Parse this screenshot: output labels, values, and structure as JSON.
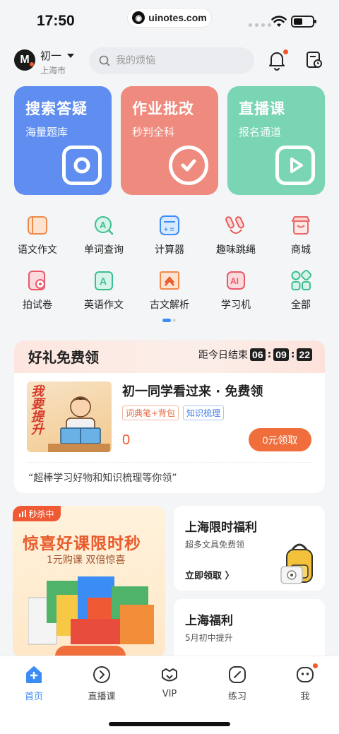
{
  "status": {
    "time": "17:50",
    "url": "uinotes.com"
  },
  "header": {
    "avatar_text": "M",
    "grade": "初一",
    "city": "上海市",
    "search_placeholder": "我的烦恼"
  },
  "big_cards": [
    {
      "title": "搜索答疑",
      "sub": "海量题库",
      "color": "#5f8ef0"
    },
    {
      "title": "作业批改",
      "sub": "秒判全科",
      "color": "#ef8a7e"
    },
    {
      "title": "直播课",
      "sub": "报名通道",
      "color": "#79d5b4"
    }
  ],
  "grid": [
    {
      "label": "语文作文",
      "icon": "composition-icon"
    },
    {
      "label": "单词查询",
      "icon": "word-lookup-icon"
    },
    {
      "label": "计算器",
      "icon": "calculator-icon"
    },
    {
      "label": "趣味跳绳",
      "icon": "jump-rope-icon"
    },
    {
      "label": "商城",
      "icon": "shop-icon"
    },
    {
      "label": "拍试卷",
      "icon": "scan-paper-icon"
    },
    {
      "label": "英语作文",
      "icon": "english-writing-icon"
    },
    {
      "label": "古文解析",
      "icon": "classical-text-icon"
    },
    {
      "label": "学习机",
      "icon": "ai-learning-icon"
    },
    {
      "label": "全部",
      "icon": "all-apps-icon"
    }
  ],
  "gift": {
    "title": "好礼免费领",
    "countdown_label": "距今日结束",
    "hh": "06",
    "mm": "09",
    "ss": "22",
    "thumb_text": "我要提升",
    "name": "初一同学看过来 · 免费领",
    "tag1": "词典笔+背包",
    "tag2": "知识梳理",
    "price": "0",
    "button": "0元领取",
    "quote": "“超棒学习好物和知识梳理等你领”"
  },
  "promo_left": {
    "badge": "秒杀中",
    "headline": "惊喜好课限时秒",
    "sub": "1元购课 双倍惊喜"
  },
  "promo_right": [
    {
      "title": "上海限时福利",
      "sub": "超多文具免费领",
      "link": "立即领取 〉"
    },
    {
      "title": "上海福利",
      "sub": "5月初中提升"
    }
  ],
  "tabs": [
    {
      "label": "首页",
      "icon": "home-icon",
      "active": true
    },
    {
      "label": "直播课",
      "icon": "live-icon"
    },
    {
      "label": "VIP",
      "icon": "vip-icon"
    },
    {
      "label": "练习",
      "icon": "practice-icon"
    },
    {
      "label": "我",
      "icon": "profile-icon"
    }
  ]
}
